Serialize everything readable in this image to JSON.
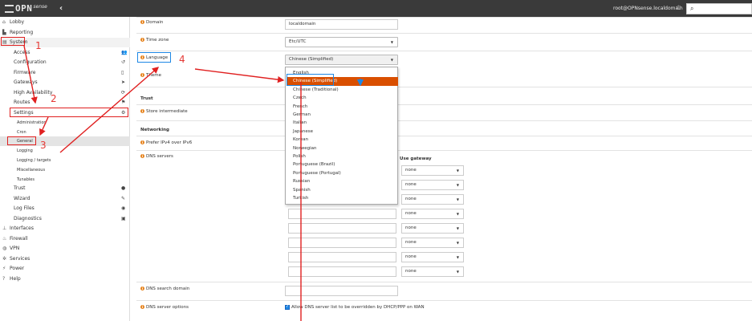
{
  "topbar": {
    "logo_text": "OPN",
    "logo_sub": "sense",
    "collapse_glyph": "‹",
    "user": "root@OPNsense.localdomain",
    "power_glyph": "⏻",
    "search_glyph": "⌕"
  },
  "sidebar": {
    "lobby": "Lobby",
    "reporting": "Reporting",
    "system": "System",
    "access": "Access",
    "configuration": "Configuration",
    "firmware": "Firmware",
    "gateways": "Gateways",
    "high_availability": "High Availability",
    "routes": "Routes",
    "settings": "Settings",
    "administration": "Administration",
    "cron": "Cron",
    "general": "General",
    "logging": "Logging",
    "logging_targets": "Logging / targets",
    "miscellaneous": "Miscellaneous",
    "tunables": "Tunables",
    "trust": "Trust",
    "wizard": "Wizard",
    "log_files": "Log Files",
    "diagnostics": "Diagnostics",
    "interfaces": "Interfaces",
    "firewall": "Firewall",
    "vpn": "VPN",
    "services": "Services",
    "power": "Power",
    "help": "Help"
  },
  "form": {
    "domain_label": "Domain",
    "domain_value": "localdomain",
    "timezone_label": "Time zone",
    "timezone_value": "Etc/UTC",
    "language_label": "Language",
    "language_value": "Chinese (Simplified)",
    "theme_label": "Theme",
    "trust_section": "Trust",
    "store_intermediate_label": "Store intermediate",
    "networking_section": "Networking",
    "prefer_ipv4_label": "Prefer IPv4 over IPv6",
    "dns_servers_label": "DNS servers",
    "use_gateway_header": "Use gateway",
    "gateway_default": "none",
    "dns_search_domain_label": "DNS search domain",
    "dns_server_options_label": "DNS server options",
    "allow_override_text": "Allow DNS server list to be overridden by DHCP/PPP on WAN"
  },
  "language_options": [
    "English",
    "Chinese (Simplified)",
    "Chinese (Traditional)",
    "Czech",
    "French",
    "German",
    "Italian",
    "Japanese",
    "Korean",
    "Norwegian",
    "Polish",
    "Portuguese (Brazil)",
    "Portuguese (Portugal)",
    "Russian",
    "Spanish",
    "Turkish"
  ],
  "selected_language_index": 1,
  "annotations": {
    "step1": "1",
    "step2": "2",
    "step3": "3",
    "step4": "4"
  },
  "colors": {
    "topbar": "#3a3a3a",
    "accent_orange": "#d94f00",
    "annotation_red": "#e02020",
    "annotation_blue": "#1e88e5"
  }
}
